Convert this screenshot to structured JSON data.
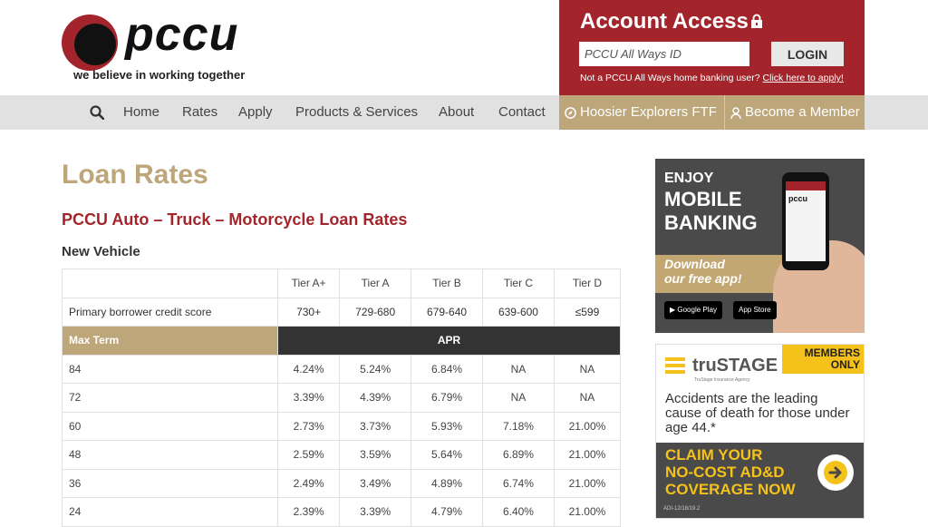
{
  "logo": {
    "name": "pccu",
    "tagline": "we believe in working together"
  },
  "account": {
    "title": "Account Access",
    "id_placeholder": "PCCU All Ways ID",
    "login_label": "LOGIN",
    "note_prefix": "Not a PCCU All Ways home banking user? ",
    "note_link": "Click here to apply!"
  },
  "nav": {
    "items": [
      "Home",
      "Rates",
      "Apply",
      "Products & Services",
      "About",
      "Contact"
    ],
    "gold": [
      "Hoosier Explorers FTF",
      "Become a Member"
    ]
  },
  "content": {
    "page_title": "Loan Rates",
    "section_title": "PCCU Auto – Truck – Motorcycle Loan Rates",
    "sub_title": "New Vehicle"
  },
  "table": {
    "tiers": [
      "Tier A+",
      "Tier A",
      "Tier B",
      "Tier C",
      "Tier D"
    ],
    "score_label": "Primary borrower credit score",
    "scores": [
      "730+",
      "729-680",
      "679-640",
      "639-600",
      "≤599"
    ],
    "max_term_label": "Max Term",
    "apr_label": "APR",
    "rows": [
      {
        "term": "84",
        "rates": [
          "4.24%",
          "5.24%",
          "6.84%",
          "NA",
          "NA"
        ]
      },
      {
        "term": "72",
        "rates": [
          "3.39%",
          "4.39%",
          "6.79%",
          "NA",
          "NA"
        ]
      },
      {
        "term": "60",
        "rates": [
          "2.73%",
          "3.73%",
          "5.93%",
          "7.18%",
          "21.00%"
        ]
      },
      {
        "term": "48",
        "rates": [
          "2.59%",
          "3.59%",
          "5.64%",
          "6.89%",
          "21.00%"
        ]
      },
      {
        "term": "36",
        "rates": [
          "2.49%",
          "3.49%",
          "4.89%",
          "6.74%",
          "21.00%"
        ]
      },
      {
        "term": "24",
        "rates": [
          "2.39%",
          "3.39%",
          "4.79%",
          "6.40%",
          "21.00%"
        ]
      }
    ]
  },
  "ads": {
    "mobile": {
      "enjoy": "ENJOY",
      "line1": "MOBILE",
      "line2": "BANKING",
      "download1": "Download",
      "download2": "our free app!",
      "google": "Google Play",
      "apple": "App Store",
      "phone_logo": "pccu"
    },
    "trustage": {
      "members1": "MEMBERS",
      "members2": "ONLY",
      "brand": "truSTAGE",
      "brand_sub": "TruStage Insurance Agency",
      "message": "Accidents are the leading cause of death for those under age 44.*",
      "claim1": "CLAIM YOUR",
      "claim2": "NO-COST AD&D",
      "claim3": "COVERAGE NOW",
      "fine": "ADI-12/18/19.2"
    }
  },
  "colors": {
    "brand_red": "#a3252b",
    "gold": "#bca67a",
    "dark": "#333333"
  }
}
